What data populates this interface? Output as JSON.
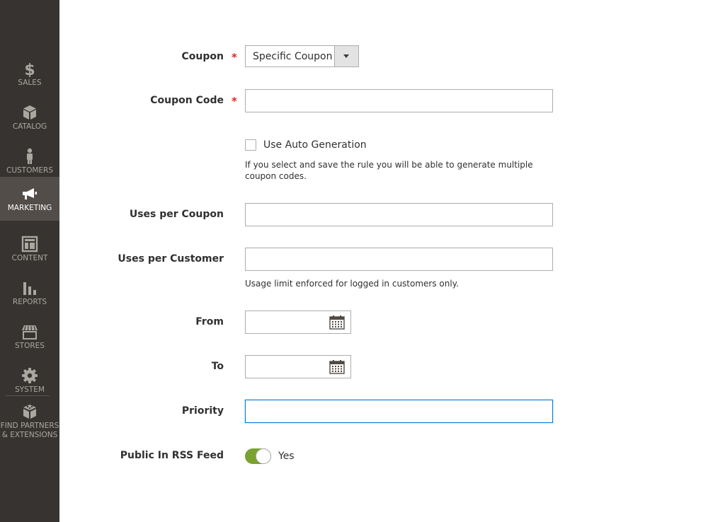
{
  "sidebar": {
    "items": [
      {
        "id": "sales",
        "label": "SALES",
        "icon": "dollar-icon"
      },
      {
        "id": "catalog",
        "label": "CATALOG",
        "icon": "box-icon"
      },
      {
        "id": "customers",
        "label": "CUSTOMERS",
        "icon": "person-icon"
      },
      {
        "id": "marketing",
        "label": "MARKETING",
        "icon": "megaphone-icon",
        "active": true
      },
      {
        "id": "content",
        "label": "CONTENT",
        "icon": "layout-icon"
      },
      {
        "id": "reports",
        "label": "REPORTS",
        "icon": "bar-chart-icon"
      },
      {
        "id": "stores",
        "label": "STORES",
        "icon": "storefront-icon"
      },
      {
        "id": "system",
        "label": "SYSTEM",
        "icon": "gear-icon"
      }
    ],
    "extensions": {
      "line1": "FIND PARTNERS",
      "line2": "& EXTENSIONS",
      "icon": "blocks-icon"
    }
  },
  "form": {
    "coupon": {
      "label": "Coupon",
      "required_mark": "*",
      "value": "Specific Coupon"
    },
    "coupon_code": {
      "label": "Coupon Code",
      "required_mark": "*",
      "value": ""
    },
    "auto_generation": {
      "label": "Use Auto Generation",
      "checked": false,
      "note": "If you select and save the rule you will be able to generate multiple coupon codes."
    },
    "uses_per_coupon": {
      "label": "Uses per Coupon",
      "value": ""
    },
    "uses_per_customer": {
      "label": "Uses per Customer",
      "value": "",
      "note": "Usage limit enforced for logged in customers only."
    },
    "from": {
      "label": "From",
      "value": ""
    },
    "to": {
      "label": "To",
      "value": ""
    },
    "priority": {
      "label": "Priority",
      "value": ""
    },
    "rss": {
      "label": "Public In RSS Feed",
      "state_label": "Yes",
      "on": true
    }
  },
  "colors": {
    "sidebar_bg": "#373330",
    "sidebar_active_bg": "#524d49",
    "required": "#e22626",
    "toggle_on": "#79a22e",
    "focus_border": "#007bdb"
  }
}
